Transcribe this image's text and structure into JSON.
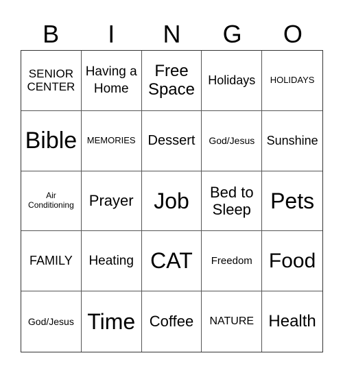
{
  "header": {
    "letters": [
      "B",
      "I",
      "N",
      "G",
      "O"
    ]
  },
  "board": {
    "cells": [
      "SENIOR CENTER",
      "Having a Home",
      "Free Space",
      "Holidays",
      "HOLIDAYS",
      "Bible",
      "MEMORIES",
      "Dessert",
      "God/Jesus",
      "Sunshine",
      "Air Conditioning",
      "Prayer",
      "Job",
      "Bed to Sleep",
      "Pets",
      "FAMILY",
      "Heating",
      "CAT",
      "Freedom",
      "Food",
      "God/Jesus",
      "Time",
      "Coffee",
      "NATURE",
      "Health"
    ],
    "free_space_index": 2
  }
}
